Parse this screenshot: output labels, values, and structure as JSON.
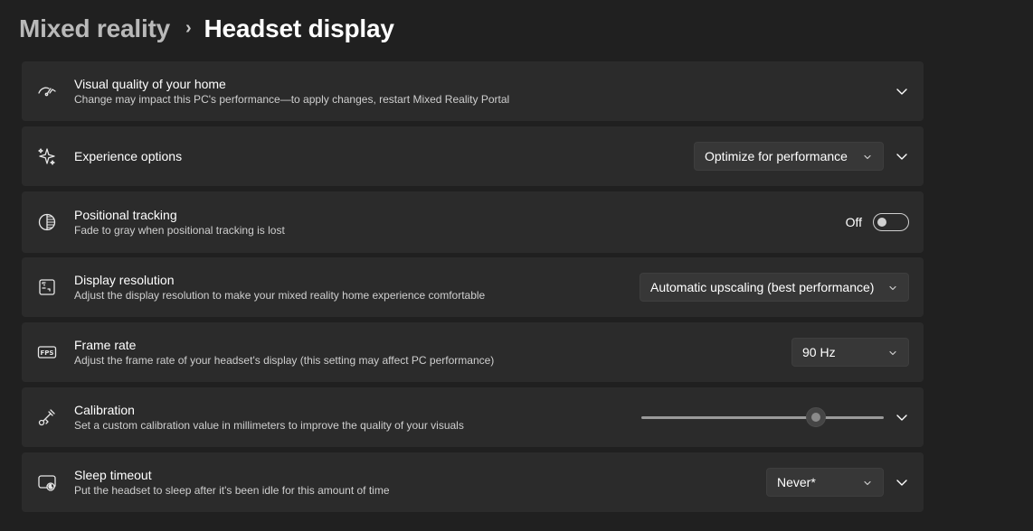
{
  "breadcrumb": {
    "parent": "Mixed reality",
    "separator": "›",
    "current": "Headset display"
  },
  "settings": {
    "visual_quality": {
      "title": "Visual quality of your home",
      "description": "Change may impact this PC's performance—to apply changes, restart Mixed Reality Portal",
      "icon": "gauge-icon"
    },
    "experience_options": {
      "title": "Experience options",
      "selected": "Optimize for performance",
      "icon": "sparkle-icon"
    },
    "positional_tracking": {
      "title": "Positional tracking",
      "description": "Fade to gray when positional tracking is lost",
      "toggle_label": "Off",
      "toggle_on": false,
      "icon": "half-circle-icon"
    },
    "display_resolution": {
      "title": "Display resolution",
      "description": "Adjust the display resolution to make your mixed reality home experience comfortable",
      "selected": "Automatic upscaling (best performance)",
      "icon": "resolution-icon"
    },
    "frame_rate": {
      "title": "Frame rate",
      "description": "Adjust the frame rate of your headset's display (this setting may affect PC performance)",
      "selected": "90 Hz",
      "icon": "fps-icon"
    },
    "calibration": {
      "title": "Calibration",
      "description": "Set a custom calibration value in millimeters to improve the quality of your visuals",
      "slider_fraction": 0.72,
      "icon": "ruler-icon"
    },
    "sleep_timeout": {
      "title": "Sleep timeout",
      "description": "Put the headset to sleep after it's been idle for this amount of time",
      "selected": "Never*",
      "icon": "sleep-icon"
    }
  },
  "colors": {
    "background": "#202020",
    "card": "#2b2b2b",
    "dropdown": "#373737"
  }
}
